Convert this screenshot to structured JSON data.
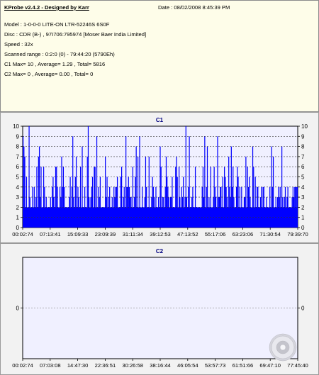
{
  "header": {
    "title": "KProbe v2.4.2 - Designed by Karr",
    "date_label": "Date : 08/02/2008 8:45:39 PM"
  },
  "info_lines": [
    "Model : 1-0-0-0 LITE-ON LTR-52246S     6S0F",
    "Disc : CDR (B-) , 97I706:795974 [Moser Baer India Limited]",
    "Speed : 32x",
    "Scanned range : 0:2:0 (0) - 79:44:20 (5790Eh)",
    "C1 Max= 10 , Average= 1.29 , Total= 5816",
    "C2 Max= 0 , Average= 0.00 , Total= 0"
  ],
  "colors": {
    "bar": "#0000ff",
    "plot_bg": "#f0f0ff",
    "title": "#000080",
    "panel_bg": "#f2f2f2",
    "info_bg": "#fefde9"
  },
  "chart_data": [
    {
      "type": "bar",
      "title": "C1",
      "x_tick_labels": [
        "00:02:74",
        "07:13:41",
        "15:09:33",
        "23:09:39",
        "31:11:34",
        "39:12:53",
        "47:13:52",
        "55:17:06",
        "63:23:06",
        "71:30:54",
        "79:39:70"
      ],
      "ylim": [
        0,
        10
      ],
      "y_ticks": [
        0,
        1,
        2,
        3,
        4,
        5,
        6,
        7,
        8,
        9,
        10
      ],
      "grid": true,
      "baseline": 2,
      "values": [
        9,
        8,
        7,
        2,
        5,
        1,
        2,
        10,
        3,
        1,
        1,
        4,
        2,
        4,
        1,
        3,
        6,
        2,
        7,
        8,
        3,
        6,
        1,
        2,
        6,
        4,
        1,
        3,
        2,
        1,
        2,
        1,
        3,
        1,
        4,
        5,
        3,
        2,
        6,
        6,
        4,
        2,
        1,
        4,
        3,
        7,
        4,
        6,
        4,
        1,
        2,
        1,
        2,
        2,
        3,
        5,
        1,
        4,
        9,
        3,
        2,
        5,
        7,
        2,
        4,
        3,
        1,
        6,
        1,
        8,
        2,
        2,
        4,
        2,
        1,
        7,
        10,
        3,
        2,
        3,
        4,
        5,
        1,
        6,
        6,
        2,
        9,
        1,
        4,
        3,
        5,
        1,
        2,
        2,
        2,
        2,
        7,
        3,
        5,
        1,
        3,
        4,
        1,
        2,
        3,
        1,
        4,
        3,
        4,
        4,
        5,
        2,
        2,
        1,
        5,
        6,
        2,
        3,
        4,
        1,
        9,
        4,
        4,
        5,
        4,
        3,
        3,
        1,
        6,
        1,
        3,
        5,
        8,
        2,
        7,
        1,
        9,
        2,
        1,
        4,
        2,
        2,
        3,
        7,
        4,
        2,
        2,
        7,
        2,
        1,
        3,
        5,
        4,
        3,
        1,
        4,
        1,
        2,
        3,
        1,
        8,
        6,
        1,
        3,
        3,
        2,
        4,
        7,
        5,
        4,
        3,
        2,
        3,
        3,
        5,
        1,
        2,
        1,
        6,
        7,
        5,
        2,
        6,
        3,
        2,
        4,
        3,
        5,
        1,
        3,
        10,
        3,
        1,
        4,
        9,
        1,
        2,
        3,
        4,
        2,
        2,
        6,
        1,
        2,
        1,
        1,
        1,
        1,
        2,
        4,
        6,
        3,
        9,
        2,
        4,
        8,
        1,
        3,
        2,
        6,
        1,
        2,
        3,
        6,
        4,
        3,
        2,
        9,
        3,
        3,
        4,
        4,
        1,
        5,
        2,
        6,
        5,
        4,
        3,
        1,
        7,
        4,
        3,
        8,
        4,
        6,
        3,
        2,
        1,
        4,
        6,
        5,
        1,
        4,
        1,
        4,
        2,
        2,
        3,
        3,
        7,
        1,
        6,
        4,
        5,
        3,
        2,
        1,
        8,
        6,
        2,
        5,
        2,
        4,
        4,
        1,
        2,
        3,
        4,
        1,
        4,
        4,
        1,
        2,
        3,
        1,
        1,
        1,
        4,
        2,
        8,
        4,
        7,
        2,
        1,
        3,
        2,
        3,
        4,
        3,
        4,
        2,
        8,
        3,
        2,
        3,
        4,
        1,
        3,
        4,
        1,
        2,
        1,
        2,
        3,
        4,
        3,
        4,
        4,
        4,
        4
      ]
    },
    {
      "type": "bar",
      "title": "C2",
      "x_tick_labels": [
        "00:02:74",
        "07:03:08",
        "14:47:30",
        "22:36:51",
        "30:26:58",
        "38:16:44",
        "46:05:54",
        "53:57:73",
        "61:51:66",
        "69:47:10",
        "77:45:40"
      ],
      "ylim": [
        -1,
        1
      ],
      "y_ticks": [
        0
      ],
      "grid": false,
      "values": []
    }
  ]
}
